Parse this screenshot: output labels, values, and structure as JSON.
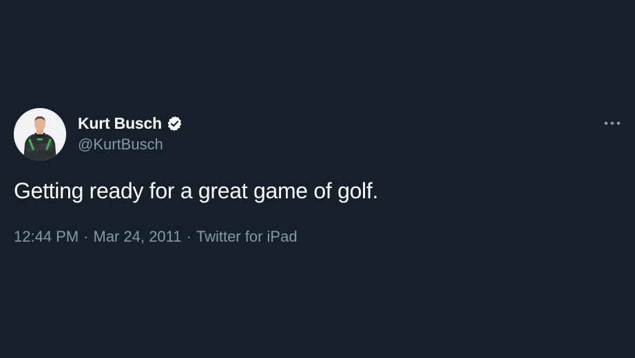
{
  "tweet": {
    "author": {
      "display_name": "Kurt Busch",
      "handle": "@KurtBusch",
      "verified": true,
      "verified_icon": "verified-badge-icon",
      "avatar": "profile-photo"
    },
    "text": "Getting ready for a great game of golf.",
    "time": "12:44 PM",
    "date": "Mar 24, 2011",
    "source": "Twitter for iPad",
    "separator": "·",
    "more_icon": "more-options-icon"
  },
  "colors": {
    "background": "#15202b",
    "primary_text": "#ffffff",
    "secondary_text": "#8899a6"
  }
}
